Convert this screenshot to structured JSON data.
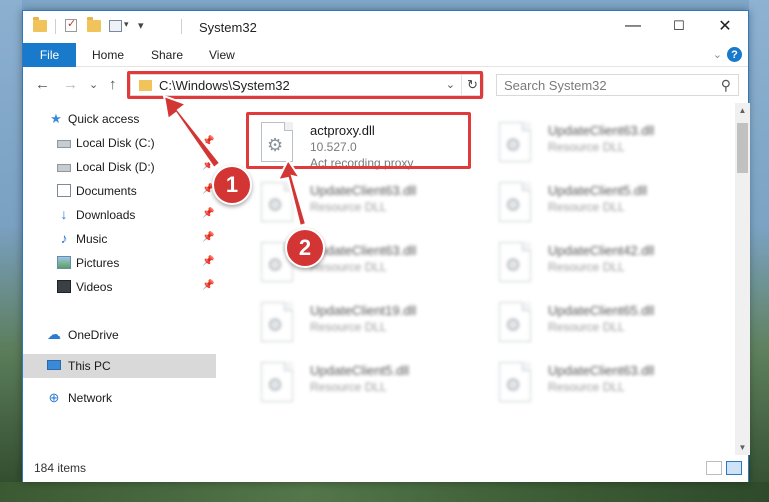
{
  "window": {
    "title": "System32",
    "controls": {
      "minimize": "—",
      "maximize": "☐",
      "close": "✕"
    }
  },
  "ribbon": {
    "tabs": [
      "File",
      "Home",
      "Share",
      "View"
    ],
    "help": "?"
  },
  "address_bar": {
    "path": "C:\\Windows\\System32",
    "refresh_icon": "↻",
    "dropdown_icon": "⌄"
  },
  "search": {
    "placeholder": "Search System32",
    "icon": "⚲"
  },
  "nav_buttons": {
    "back": "←",
    "forward": "→",
    "recent": "⌄",
    "up": "↑"
  },
  "sidebar": {
    "items": [
      {
        "label": "Quick access",
        "icon": "star-icon",
        "pinned": false
      },
      {
        "label": "Local Disk (C:)",
        "icon": "drive-icon",
        "pinned": true
      },
      {
        "label": "Local Disk (D:)",
        "icon": "drive-icon",
        "pinned": true
      },
      {
        "label": "Documents",
        "icon": "documents-icon",
        "pinned": true
      },
      {
        "label": "Downloads",
        "icon": "download-icon",
        "pinned": true
      },
      {
        "label": "Music",
        "icon": "music-icon",
        "pinned": true
      },
      {
        "label": "Pictures",
        "icon": "pictures-icon",
        "pinned": true
      },
      {
        "label": "Videos",
        "icon": "videos-icon",
        "pinned": true
      },
      {
        "label": "OneDrive",
        "icon": "cloud-icon",
        "pinned": false
      },
      {
        "label": "This PC",
        "icon": "computer-icon",
        "pinned": false,
        "selected": true
      },
      {
        "label": "Network",
        "icon": "network-icon",
        "pinned": false
      }
    ]
  },
  "files": [
    {
      "name": "actproxy.dll",
      "line2": "10.527.0",
      "line3": "Act recording proxy",
      "highlighted": true
    },
    {
      "name": "UpdateClient63.dll",
      "line2": "Resource DLL",
      "blurred": true
    },
    {
      "name": "UpdateClient63.dll",
      "line2": "Resource DLL",
      "blurred": true
    },
    {
      "name": "UpdateClient5.dll",
      "line2": "Resource DLL",
      "blurred": true
    },
    {
      "name": "UpdateClient63.dll",
      "line2": "Resource DLL",
      "blurred": true
    },
    {
      "name": "UpdateClient42.dll",
      "line2": "Resource DLL",
      "blurred": true
    },
    {
      "name": "UpdateClient19.dll",
      "line2": "Resource DLL",
      "blurred": true
    },
    {
      "name": "UpdateClient65.dll",
      "line2": "Resource DLL",
      "blurred": true
    },
    {
      "name": "UpdateClient5.dll",
      "line2": "Resource DLL",
      "blurred": true
    },
    {
      "name": "UpdateClient63.dll",
      "line2": "Resource DLL",
      "blurred": true
    }
  ],
  "status": {
    "item_count": "184 items"
  },
  "callouts": [
    {
      "number": "1",
      "target": "address-bar"
    },
    {
      "number": "2",
      "target": "actproxy-file"
    }
  ],
  "colors": {
    "accent": "#1979ca",
    "highlight": "#e03a3a",
    "badge": "#d33535"
  }
}
